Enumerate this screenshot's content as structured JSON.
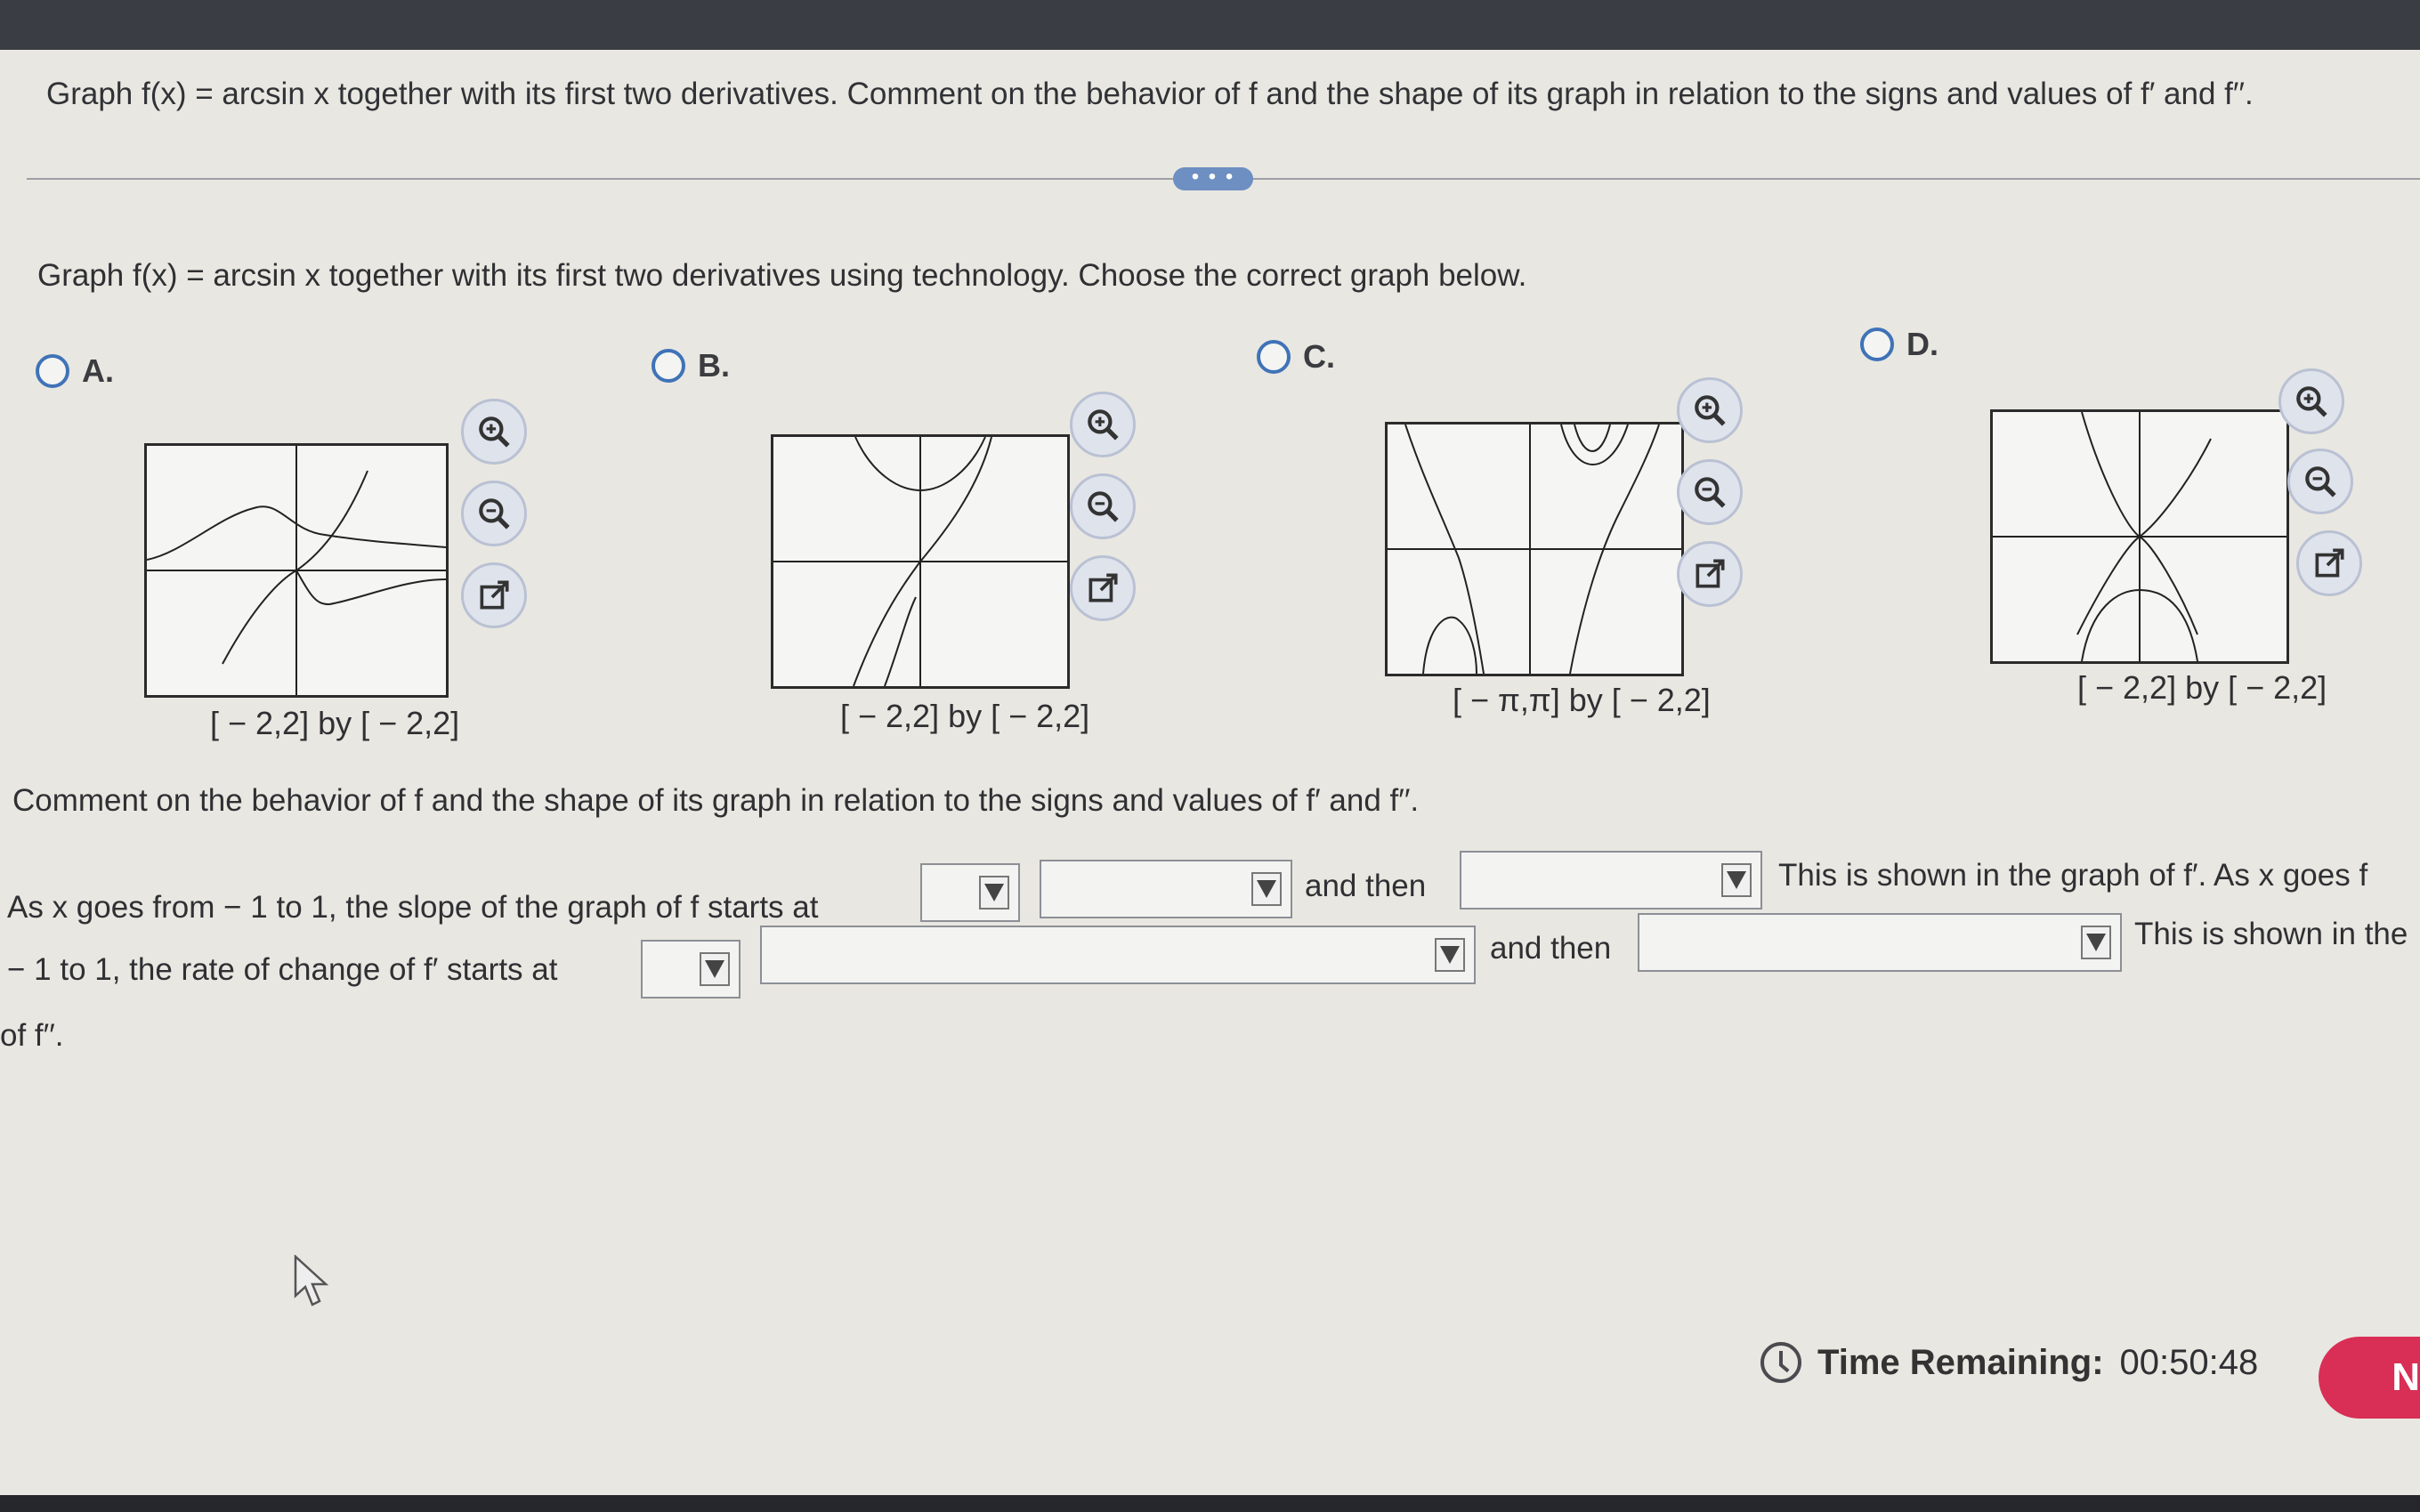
{
  "header": {
    "question": "Graph f(x) = arcsin x together with its first two derivatives. Comment on the behavior of f and the shape of its graph in relation to the signs and values of f′ and f′′."
  },
  "divider_handle": "• • •",
  "part1": {
    "prompt": "Graph f(x) = arcsin x together with its first two derivatives using technology. Choose the correct graph below.",
    "options": [
      {
        "letter": "A.",
        "window": "[ − 2,2] by [ − 2,2]"
      },
      {
        "letter": "B.",
        "window": "[ − 2,2] by [ − 2,2]"
      },
      {
        "letter": "C.",
        "window": "[ − π,π] by [ − 2,2]"
      },
      {
        "letter": "D.",
        "window": "[ − 2,2] by [ − 2,2]"
      }
    ],
    "icons": [
      "zoom-in-icon",
      "zoom-out-icon",
      "external-link-icon"
    ]
  },
  "part2": {
    "prompt": "Comment on the behavior of f and the shape of its graph in relation to the signs and values of f′ and f′′.",
    "line1_start": "As x goes from  − 1 to 1, the slope of the graph of f starts at",
    "line1_mid": "and  then",
    "line1_end": "This is shown in the graph of f′. As x goes f",
    "line2_start": " − 1 to 1, the rate of change of f′ starts at",
    "line2_mid": "and then",
    "line2_end": "This is shown in the",
    "line3": "of f′′.",
    "dropdowns": [
      "",
      "",
      "",
      "",
      "",
      ""
    ]
  },
  "footer": {
    "timer_label": "Time Remaining:",
    "timer_value": "00:50:48",
    "next_label": "N"
  },
  "colors": {
    "accent": "#3f73b8",
    "next_button": "#d92e55",
    "topbar": "#3b3d45"
  }
}
